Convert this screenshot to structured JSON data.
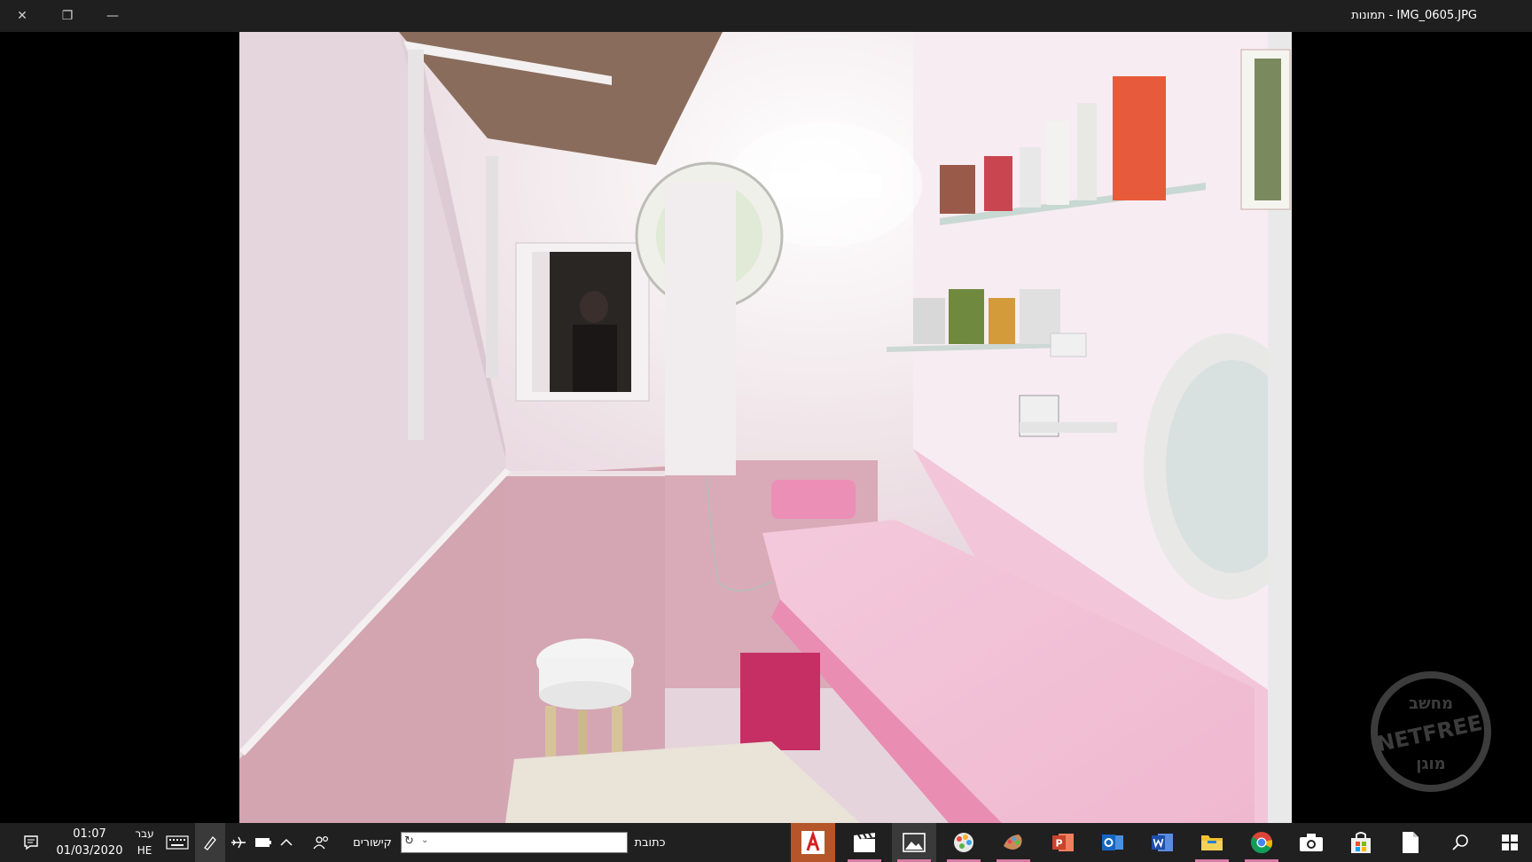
{
  "window": {
    "title": "IMG_0605.JPG - תמונות",
    "close_glyph": "✕",
    "restore_glyph": "❐",
    "minimize_glyph": "—"
  },
  "watermark": {
    "top_text": "מחשב",
    "middle_text": "NETFREE",
    "bottom_text": "מוגן"
  },
  "taskbar": {
    "time": "01:07",
    "date": "01/03/2020",
    "lang_top": "עבר",
    "lang_bottom": "HE",
    "address_label": "כתובת",
    "address_value": "",
    "links_label": "קישורים",
    "refresh_glyph": "↻",
    "dropdown_glyph": "⌄"
  },
  "colors": {
    "taskbar_bg": "#202020",
    "titlebar_bg": "#1f1f1f",
    "active_indicator": "#d77ba5"
  }
}
